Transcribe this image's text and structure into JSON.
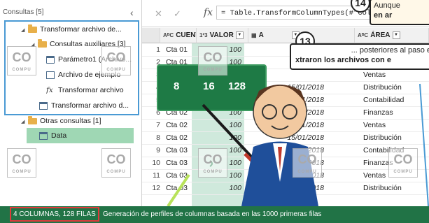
{
  "queries_pane": {
    "header": "Consultas [5]",
    "items": [
      {
        "label": "Transformar archivo de..."
      },
      {
        "label": "Consultas auxiliares [3]"
      },
      {
        "label": "Parámetro1 (Archivo..."
      },
      {
        "label": "Archivo de ejemplo"
      },
      {
        "label": "Transformar archivo"
      },
      {
        "label": "Transformar archivo d..."
      },
      {
        "label": "Otras consultas [1]"
      },
      {
        "label": "Data"
      }
    ]
  },
  "formula_bar": {
    "formula": "= Table.TransformColumnTypes(#\"Columna c"
  },
  "grid": {
    "columns": [
      {
        "type": "AᴮC",
        "label": "CUENTA"
      },
      {
        "type": "1²3",
        "label": "VALOR"
      },
      {
        "type": "",
        "label": "A"
      },
      {
        "type": "AᴮC",
        "label": "ÁREA"
      }
    ],
    "rows": [
      {
        "n": "1",
        "cuenta": "Cta 01",
        "valor": "100",
        "fecha": "",
        "area": ""
      },
      {
        "n": "2",
        "cuenta": "Cta 01",
        "valor": "100",
        "fecha": "",
        "area": ""
      },
      {
        "n": "3",
        "cuenta": "Cta 01",
        "valor": "100",
        "fecha": "",
        "area": "Ventas"
      },
      {
        "n": "4",
        "cuenta": "Cta 01",
        "valor": "100",
        "fecha": "15/01/2018",
        "area": "Distribución"
      },
      {
        "n": "5",
        "cuenta": "Cta 01",
        "valor": "100",
        "fecha": "15/01/2018",
        "area": "Contabilidad"
      },
      {
        "n": "6",
        "cuenta": "Cta 02",
        "valor": "100",
        "fecha": "15/01/2018",
        "area": "Finanzas"
      },
      {
        "n": "7",
        "cuenta": "Cta 02",
        "valor": "100",
        "fecha": "15/01/2018",
        "area": "Ventas"
      },
      {
        "n": "8",
        "cuenta": "Cta 02",
        "valor": "100",
        "fecha": "15/01/2018",
        "area": "Distribución"
      },
      {
        "n": "9",
        "cuenta": "Cta 03",
        "valor": "100",
        "fecha": "15/01/2018",
        "area": "Contabilidad"
      },
      {
        "n": "10",
        "cuenta": "Cta 03",
        "valor": "100",
        "fecha": "15/01/2018",
        "area": "Finanzas"
      },
      {
        "n": "11",
        "cuenta": "Cta 03",
        "valor": "100",
        "fecha": "15/01/2018",
        "area": "Ventas"
      },
      {
        "n": "12",
        "cuenta": "Cta 03",
        "valor": "100",
        "fecha": "15/01/2018",
        "area": "Distribución"
      }
    ]
  },
  "status_bar": {
    "counts": "4 COLUMNAS, 128 FILAS",
    "profiling": "Generación de perfiles de columnas basada en las 1000 primeras filas"
  },
  "overlay": {
    "step14_number": "14",
    "callout14_line1": "Aunque",
    "callout14_line2": "en ar",
    "step13_number": "13",
    "callout13_line1": "... posteriores al paso e",
    "callout13_line2": "xtraron los archivos con e",
    "card_values": [
      "8",
      "16",
      "128"
    ],
    "watermark": "CO",
    "watermark_sub": "COMPU"
  },
  "colors": {
    "status_green": "#217346",
    "column_highlight": "#cfe9dc",
    "frame_blue": "#4a9ad4",
    "count_box_red": "#e03a3a"
  }
}
